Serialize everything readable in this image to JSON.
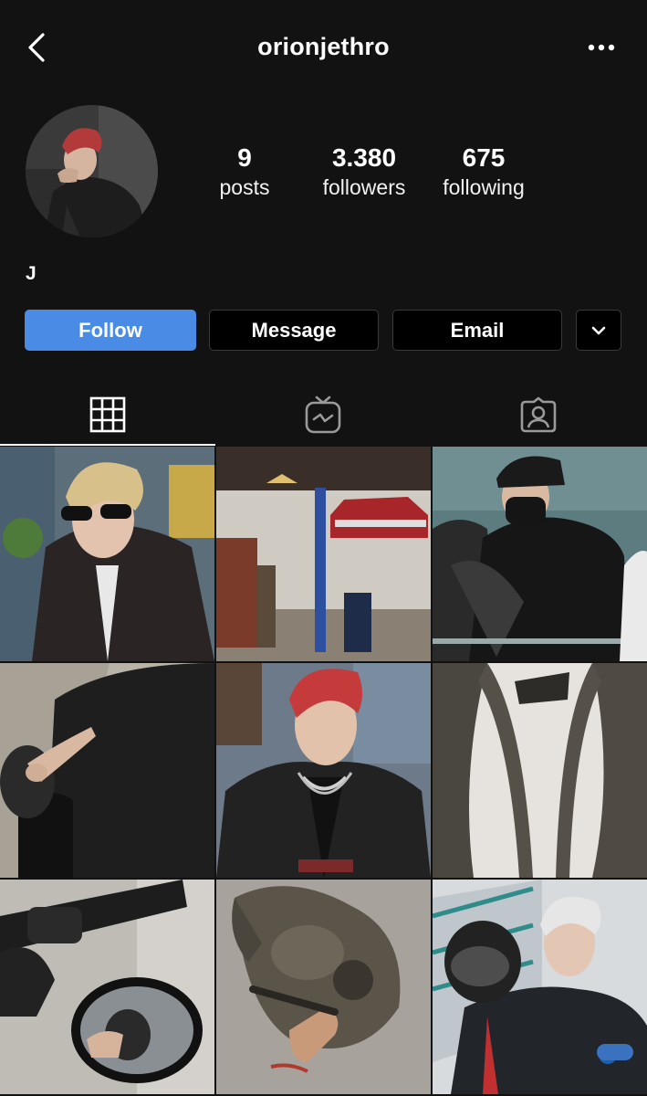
{
  "header": {
    "username": "orionjethro",
    "back_icon": "chevron-left-icon",
    "more_icon": "ellipsis-icon"
  },
  "profile": {
    "name": "J",
    "stats": [
      {
        "value": "9",
        "label": "posts"
      },
      {
        "value": "3.380",
        "label": "followers"
      },
      {
        "value": "675",
        "label": "following"
      }
    ]
  },
  "actions": {
    "follow": "Follow",
    "message": "Message",
    "email": "Email",
    "more_icon": "chevron-down-icon"
  },
  "tabs": [
    {
      "name": "posts-grid",
      "icon": "grid-icon",
      "active": true
    },
    {
      "name": "igtv",
      "icon": "igtv-icon",
      "active": false
    },
    {
      "name": "tagged",
      "icon": "tagged-person-icon",
      "active": false
    }
  ],
  "colors": {
    "background": "#121212",
    "follow_button": "#4a8ce5",
    "secondary_button": "#000000"
  }
}
